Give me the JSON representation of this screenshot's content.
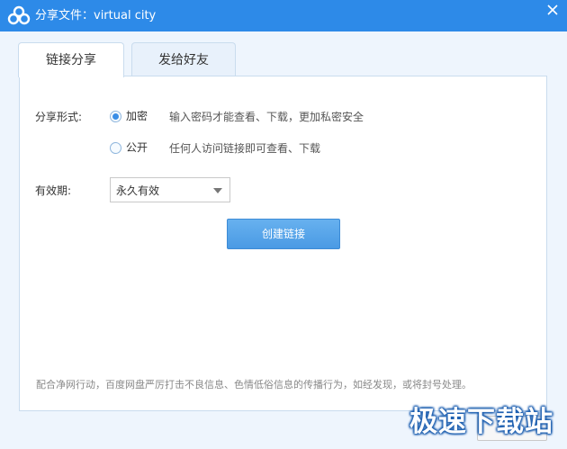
{
  "window": {
    "title": "分享文件：virtual city",
    "close_icon": "close-icon",
    "logo_icon": "cloud-logo-icon",
    "accent_color": "#2d8ae8"
  },
  "tabs": [
    {
      "label": "链接分享",
      "active": true
    },
    {
      "label": "发给好友",
      "active": false
    }
  ],
  "share_form": {
    "label": "分享形式:",
    "options": [
      {
        "label": "加密",
        "hint": "输入密码才能查看、下载，更加私密安全",
        "selected": true
      },
      {
        "label": "公开",
        "hint": "任何人访问链接即可查看、下载",
        "selected": false
      }
    ]
  },
  "validity": {
    "label": "有效期:",
    "selected": "永久有效",
    "arrow_icon": "dropdown-arrow-icon"
  },
  "create_button": {
    "label": "创建链接"
  },
  "notice": "配合净网行动，百度网盘严厉打击不良信息、色情低俗信息的传播行为，如经发现，或将封号处理。",
  "watermark": "极速下载站"
}
